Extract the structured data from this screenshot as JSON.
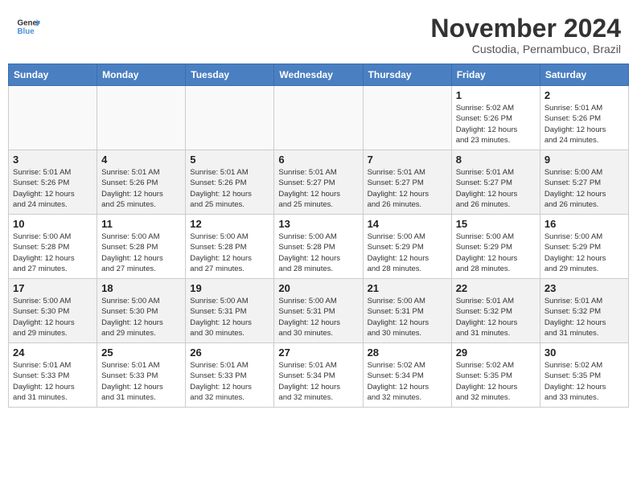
{
  "header": {
    "logo_line1": "General",
    "logo_line2": "Blue",
    "month": "November 2024",
    "location": "Custodia, Pernambuco, Brazil"
  },
  "weekdays": [
    "Sunday",
    "Monday",
    "Tuesday",
    "Wednesday",
    "Thursday",
    "Friday",
    "Saturday"
  ],
  "weeks": [
    [
      {
        "day": "",
        "detail": ""
      },
      {
        "day": "",
        "detail": ""
      },
      {
        "day": "",
        "detail": ""
      },
      {
        "day": "",
        "detail": ""
      },
      {
        "day": "",
        "detail": ""
      },
      {
        "day": "1",
        "detail": "Sunrise: 5:02 AM\nSunset: 5:26 PM\nDaylight: 12 hours\nand 23 minutes."
      },
      {
        "day": "2",
        "detail": "Sunrise: 5:01 AM\nSunset: 5:26 PM\nDaylight: 12 hours\nand 24 minutes."
      }
    ],
    [
      {
        "day": "3",
        "detail": "Sunrise: 5:01 AM\nSunset: 5:26 PM\nDaylight: 12 hours\nand 24 minutes."
      },
      {
        "day": "4",
        "detail": "Sunrise: 5:01 AM\nSunset: 5:26 PM\nDaylight: 12 hours\nand 25 minutes."
      },
      {
        "day": "5",
        "detail": "Sunrise: 5:01 AM\nSunset: 5:26 PM\nDaylight: 12 hours\nand 25 minutes."
      },
      {
        "day": "6",
        "detail": "Sunrise: 5:01 AM\nSunset: 5:27 PM\nDaylight: 12 hours\nand 25 minutes."
      },
      {
        "day": "7",
        "detail": "Sunrise: 5:01 AM\nSunset: 5:27 PM\nDaylight: 12 hours\nand 26 minutes."
      },
      {
        "day": "8",
        "detail": "Sunrise: 5:01 AM\nSunset: 5:27 PM\nDaylight: 12 hours\nand 26 minutes."
      },
      {
        "day": "9",
        "detail": "Sunrise: 5:00 AM\nSunset: 5:27 PM\nDaylight: 12 hours\nand 26 minutes."
      }
    ],
    [
      {
        "day": "10",
        "detail": "Sunrise: 5:00 AM\nSunset: 5:28 PM\nDaylight: 12 hours\nand 27 minutes."
      },
      {
        "day": "11",
        "detail": "Sunrise: 5:00 AM\nSunset: 5:28 PM\nDaylight: 12 hours\nand 27 minutes."
      },
      {
        "day": "12",
        "detail": "Sunrise: 5:00 AM\nSunset: 5:28 PM\nDaylight: 12 hours\nand 27 minutes."
      },
      {
        "day": "13",
        "detail": "Sunrise: 5:00 AM\nSunset: 5:28 PM\nDaylight: 12 hours\nand 28 minutes."
      },
      {
        "day": "14",
        "detail": "Sunrise: 5:00 AM\nSunset: 5:29 PM\nDaylight: 12 hours\nand 28 minutes."
      },
      {
        "day": "15",
        "detail": "Sunrise: 5:00 AM\nSunset: 5:29 PM\nDaylight: 12 hours\nand 28 minutes."
      },
      {
        "day": "16",
        "detail": "Sunrise: 5:00 AM\nSunset: 5:29 PM\nDaylight: 12 hours\nand 29 minutes."
      }
    ],
    [
      {
        "day": "17",
        "detail": "Sunrise: 5:00 AM\nSunset: 5:30 PM\nDaylight: 12 hours\nand 29 minutes."
      },
      {
        "day": "18",
        "detail": "Sunrise: 5:00 AM\nSunset: 5:30 PM\nDaylight: 12 hours\nand 29 minutes."
      },
      {
        "day": "19",
        "detail": "Sunrise: 5:00 AM\nSunset: 5:31 PM\nDaylight: 12 hours\nand 30 minutes."
      },
      {
        "day": "20",
        "detail": "Sunrise: 5:00 AM\nSunset: 5:31 PM\nDaylight: 12 hours\nand 30 minutes."
      },
      {
        "day": "21",
        "detail": "Sunrise: 5:00 AM\nSunset: 5:31 PM\nDaylight: 12 hours\nand 30 minutes."
      },
      {
        "day": "22",
        "detail": "Sunrise: 5:01 AM\nSunset: 5:32 PM\nDaylight: 12 hours\nand 31 minutes."
      },
      {
        "day": "23",
        "detail": "Sunrise: 5:01 AM\nSunset: 5:32 PM\nDaylight: 12 hours\nand 31 minutes."
      }
    ],
    [
      {
        "day": "24",
        "detail": "Sunrise: 5:01 AM\nSunset: 5:33 PM\nDaylight: 12 hours\nand 31 minutes."
      },
      {
        "day": "25",
        "detail": "Sunrise: 5:01 AM\nSunset: 5:33 PM\nDaylight: 12 hours\nand 31 minutes."
      },
      {
        "day": "26",
        "detail": "Sunrise: 5:01 AM\nSunset: 5:33 PM\nDaylight: 12 hours\nand 32 minutes."
      },
      {
        "day": "27",
        "detail": "Sunrise: 5:01 AM\nSunset: 5:34 PM\nDaylight: 12 hours\nand 32 minutes."
      },
      {
        "day": "28",
        "detail": "Sunrise: 5:02 AM\nSunset: 5:34 PM\nDaylight: 12 hours\nand 32 minutes."
      },
      {
        "day": "29",
        "detail": "Sunrise: 5:02 AM\nSunset: 5:35 PM\nDaylight: 12 hours\nand 32 minutes."
      },
      {
        "day": "30",
        "detail": "Sunrise: 5:02 AM\nSunset: 5:35 PM\nDaylight: 12 hours\nand 33 minutes."
      }
    ]
  ]
}
